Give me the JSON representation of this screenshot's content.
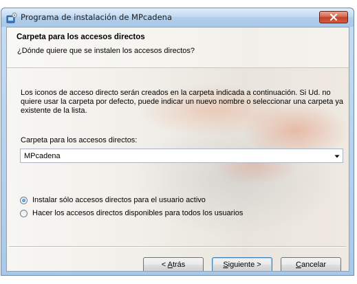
{
  "window": {
    "title": "Programa de instalación de MPcadena"
  },
  "header": {
    "title": "Carpeta para los accesos directos",
    "subtitle": "¿Dónde quiere que se instalen los accesos directos?"
  },
  "main": {
    "description": "Los iconos de acceso directo serán creados en la carpeta indicada a continuación. Si Ud. no quiere usar la carpeta por defecto, puede indicar un nuevo nombre o seleccionar una carpeta ya existente de la lista.",
    "folder_label": "Carpeta para los accesos directos:",
    "folder_value": "MPcadena",
    "options": [
      {
        "label": "Instalar sólo accesos directos para el usuario activo",
        "selected": true
      },
      {
        "label": "Hacer los accesos directos disponibles para todos los usuarios",
        "selected": false
      }
    ]
  },
  "buttons": {
    "back": {
      "pre": "< ",
      "accel": "A",
      "post": "trás"
    },
    "next": {
      "pre": "",
      "accel": "S",
      "post": "iguiente >"
    },
    "cancel": {
      "pre": "",
      "accel": "C",
      "post": "ancelar"
    }
  },
  "colors": {
    "close_button": "#c4412a",
    "title_bar": "#b1cfec",
    "radio_dot": "#1f6fb6",
    "default_button_border": "#3c7fb1"
  },
  "icons": {
    "app": "installer-icon",
    "close": "close-icon",
    "dropdown": "chevron-down-icon"
  }
}
